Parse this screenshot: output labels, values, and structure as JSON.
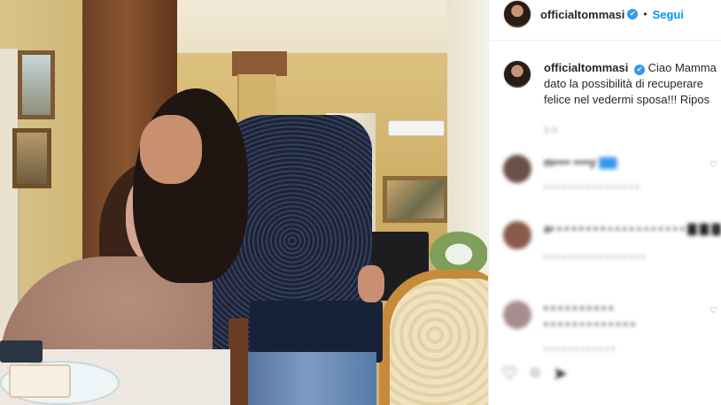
{
  "post": {
    "photo_alt": "",
    "username": "officialtommasi",
    "verified": "✔",
    "separator": "•",
    "follow_label": "Segui"
  },
  "caption": {
    "username": "officialtommasi",
    "verified": "✔",
    "line1": "Ciao Mamma",
    "line2": "dato la possibilità di recuperare",
    "line3": "felice nel vedermi sposa!!! Ripos",
    "time": "1 s"
  },
  "comments": [
    {
      "user": "m•••• ••••y",
      "text": "▇▇",
      "meta": "• • • • • • • • • • •  •  • • • •",
      "avatar_color": "#6b5148"
    },
    {
      "user": "a• • • • • •  • •",
      "text": "• • • • • • • • • • •  ▇ ▇ ▇",
      "meta": "• • • • • • • • • • • • •  • • • •",
      "avatar_color": "#8a5a4a"
    },
    {
      "user": "• • • • • • • • • •",
      "text": "• • • • • • • • • • • • •",
      "meta": "• • • • • • • • • • • •",
      "avatar_color": "#a88d8f"
    }
  ],
  "icons": {
    "verified": "verified-badge-icon",
    "heart": "heart-icon",
    "comment": "comment-icon",
    "share": "share-icon",
    "save": "bookmark-icon"
  },
  "colors": {
    "link_blue": "#0095f6",
    "verified_blue": "#3897f0",
    "text": "#262626",
    "muted": "#8e8e8e"
  }
}
